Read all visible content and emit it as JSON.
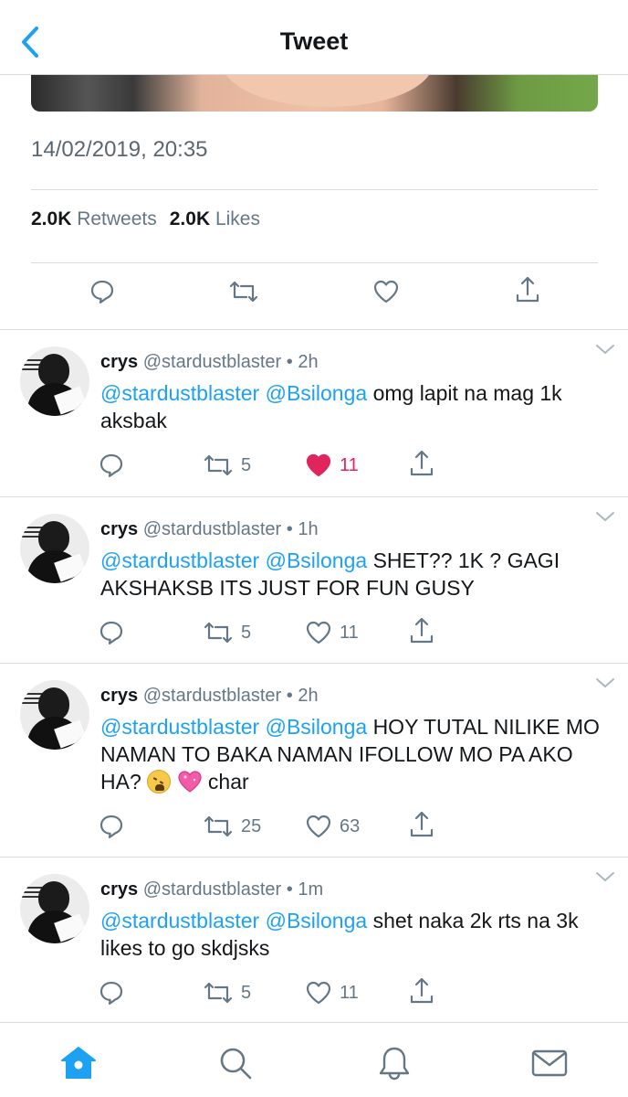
{
  "nav": {
    "title": "Tweet",
    "back_icon": "chevron-left-icon"
  },
  "tweet": {
    "timestamp": "14/02/2019, 20:35",
    "retweets_count": "2.0K",
    "retweets_label": "Retweets",
    "likes_count": "2.0K",
    "likes_label": "Likes"
  },
  "replies": [
    {
      "name": "crys",
      "handle": "@stardustblaster",
      "time": "2h",
      "mention1": "@stardustblaster",
      "mention2": "@Bsilonga",
      "text": "omg lapit na mag 1k aksbak",
      "retweets": "5",
      "likes": "11",
      "liked": true
    },
    {
      "name": "crys",
      "handle": "@stardustblaster",
      "time": "1h",
      "mention1": "@stardustblaster",
      "mention2": "@Bsilonga",
      "text": "SHET?? 1K ? GAGI AKSHAKSB ITS JUST FOR FUN GUSY",
      "retweets": "5",
      "likes": "11",
      "liked": false
    },
    {
      "name": "crys",
      "handle": "@stardustblaster",
      "time": "2h",
      "mention1": "@stardustblaster",
      "mention2": "@Bsilonga",
      "text": "HOY TUTAL NILIKE MO NAMAN TO BAKA NAMAN IFOLLOW MO PA AKO HA?",
      "text_after_emoji": "char",
      "emojis": [
        "tired-face-emoji",
        "sparkling-heart-emoji"
      ],
      "retweets": "25",
      "likes": "63",
      "liked": false
    },
    {
      "name": "crys",
      "handle": "@stardustblaster",
      "time": "1m",
      "mention1": "@stardustblaster",
      "mention2": "@Bsilonga",
      "text": "shet naka 2k rts na 3k likes to go skdjsks",
      "retweets": "5",
      "likes": "11",
      "liked": false
    }
  ],
  "separator_dot": "•",
  "colors": {
    "accent": "#1da1f2",
    "like": "#e0245e",
    "muted": "#657786",
    "tab_active": "#1da1f2"
  },
  "tabs": [
    "home-icon",
    "search-icon",
    "notifications-icon",
    "messages-icon"
  ]
}
